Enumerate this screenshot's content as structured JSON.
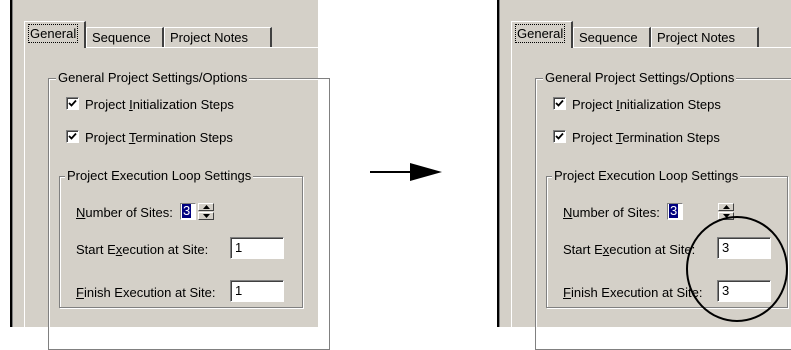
{
  "tabs": [
    {
      "label": "General"
    },
    {
      "label": "Sequence"
    },
    {
      "label": "Project Notes"
    }
  ],
  "general_group": {
    "legend": "General Project Settings/Options",
    "init_steps": {
      "pre": "Project ",
      "accel": "I",
      "post": "nitialization Steps",
      "checked": true
    },
    "term_steps": {
      "pre": "Project ",
      "accel": "T",
      "post": "ermination Steps",
      "checked": true
    }
  },
  "loop_group": {
    "legend": "Project Execution Loop Settings",
    "sites_label": {
      "pre": "",
      "accel": "N",
      "post": "umber of Sites:"
    },
    "start_label": {
      "pre": "Start E",
      "accel": "x",
      "post": "ecution at Site:"
    },
    "finish_label": {
      "pre": "",
      "accel": "F",
      "post": "inish Execution at Site:"
    }
  },
  "before": {
    "number_of_sites": "3",
    "start_site": "1",
    "finish_site": "1"
  },
  "after": {
    "number_of_sites": "3",
    "start_site": "3",
    "finish_site": "3"
  },
  "icons": {
    "arrow": "right-arrow-icon",
    "highlight": "highlight-circle",
    "check": "check-icon",
    "spin_up": "spin-up-icon",
    "spin_down": "spin-down-icon"
  },
  "colors": {
    "dialog_bg": "#d4d0c8",
    "selection": "#000080"
  }
}
